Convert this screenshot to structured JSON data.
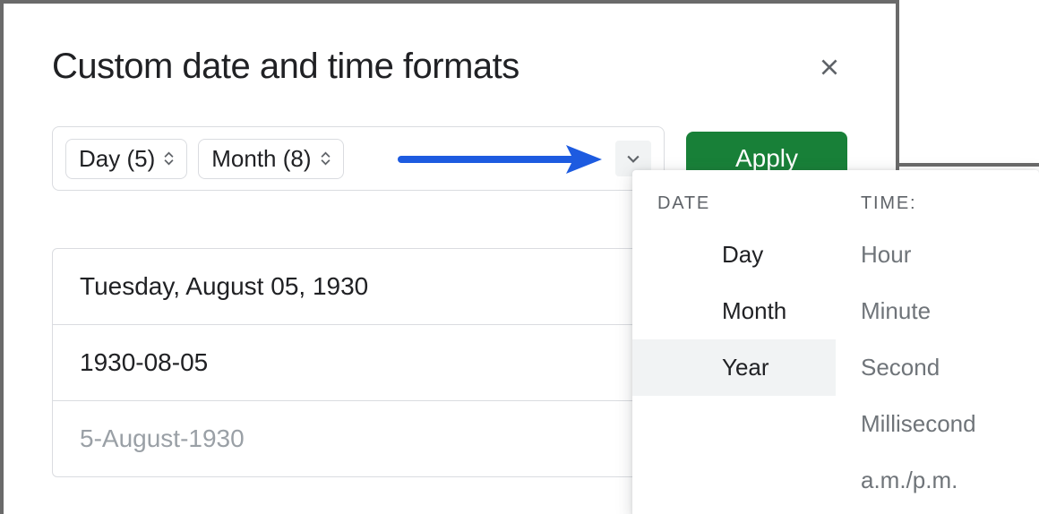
{
  "dialog": {
    "title": "Custom date and time formats",
    "apply_label": "Apply"
  },
  "tokens": {
    "day": "Day (5)",
    "month": "Month (8)"
  },
  "examples": [
    "Tuesday, August 05, 1930",
    "1930-08-05",
    "5-August-1930"
  ],
  "dropdown": {
    "date_heading": "DATE",
    "time_heading": "TIME:",
    "date_items": [
      "Day",
      "Month",
      "Year"
    ],
    "time_items": [
      "Hour",
      "Minute",
      "Second",
      "Millisecond",
      "a.m./p.m."
    ],
    "hovered_date_index": 2
  },
  "colors": {
    "apply_bg": "#188038",
    "arrow": "#1d5be0"
  }
}
